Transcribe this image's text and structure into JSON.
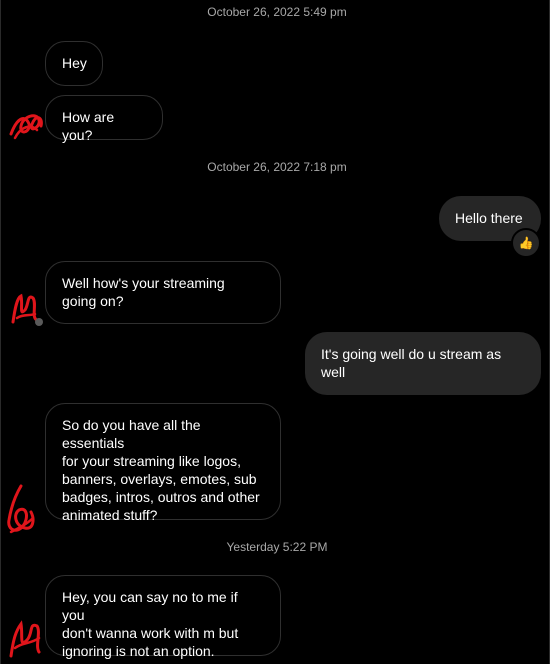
{
  "timestamps": {
    "t1": "October 26, 2022 5:49 pm",
    "t2": "October 26, 2022 7:18 pm",
    "t3": "Yesterday 5:22 PM"
  },
  "messages": [
    {
      "direction": "incoming",
      "text": "Hey"
    },
    {
      "direction": "incoming",
      "text": "How are you?"
    },
    {
      "direction": "outgoing",
      "text": "Hello there",
      "reaction": "👍"
    },
    {
      "direction": "incoming",
      "text": "Well how's your streaming\ngoing on?"
    },
    {
      "direction": "outgoing",
      "text": "It's going well do u stream as\nwell"
    },
    {
      "direction": "incoming",
      "text": "So do you have all the essentials\nfor your streaming like logos,\nbanners, overlays, emotes, sub\nbadges, intros, outros and other\nanimated stuff?"
    },
    {
      "direction": "incoming",
      "text": "Hey, you can say no to me if you\ndon't wanna work with m but\nignoring is not an option."
    }
  ],
  "colors": {
    "background": "#000000",
    "incoming_border": "#2f2f2f",
    "outgoing_bubble": "#262626",
    "timestamp_text": "#a8a8a8",
    "redaction_scribble": "#e0151b"
  }
}
